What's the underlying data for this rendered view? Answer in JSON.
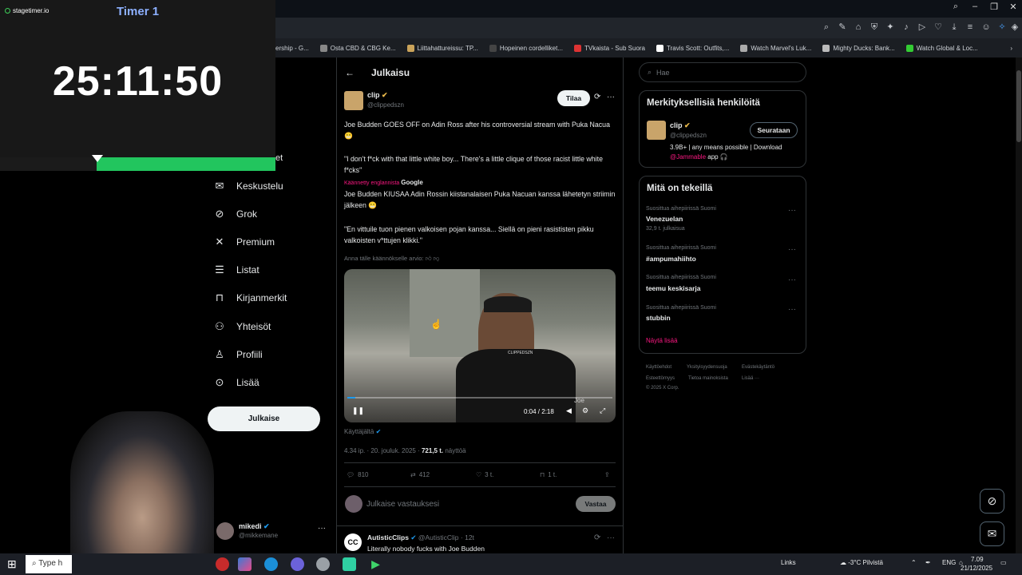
{
  "timer": {
    "brand": "stagetimer.io",
    "title": "Timer 1",
    "display": "25:11:50",
    "progress_fraction": 0.65
  },
  "bookmarks": [
    "ership - G...",
    "Osta CBD & CBG Ke...",
    "Liittahattureissu: TP...",
    "Hopeinen cordelliket...",
    "TVkaista - Sub Suora",
    "Travis Scott: Outfits,...",
    "Watch Marvel's Luk...",
    "Mighty Ducks: Bank...",
    "Watch Global & Loc..."
  ],
  "nav": {
    "partial_label": "et",
    "items": [
      {
        "label": "Keskustelu",
        "icon": "mail-icon"
      },
      {
        "label": "Grok",
        "icon": "grok-icon"
      },
      {
        "label": "Premium",
        "icon": "x-icon"
      },
      {
        "label": "Listat",
        "icon": "list-icon"
      },
      {
        "label": "Kirjanmerkit",
        "icon": "bookmark-icon"
      },
      {
        "label": "Yhteisöt",
        "icon": "communities-icon"
      },
      {
        "label": "Profiili",
        "icon": "profile-icon"
      },
      {
        "label": "Lisää",
        "icon": "more-icon"
      }
    ],
    "post_button": "Julkaise",
    "account": {
      "name": "mikedi",
      "handle": "@mikkemane"
    }
  },
  "post": {
    "header_title": "Julkaisu",
    "author_name": "clip",
    "author_handle": "@clippedszn",
    "subscribe_label": "Tilaa",
    "text_original_1": "Joe Budden GOES OFF on Adin Ross after his controversial stream with Puka Nacua 😬",
    "text_original_2": "\"I don't f*ck with that little white boy... There's a little clique of those racist little white f*cks\"",
    "translated_from": "Käännetty englannista",
    "translator": "Google",
    "text_translated_1": "Joe Budden KIUSAA Adin Rossin kiistanalaisen Puka Nacuan kanssa lähetetyn striimin jälkeen 😬",
    "text_translated_2": "\"En vittuile tuon pienen valkoisen pojan kanssa... Siellä on pieni rasististen pikku valkoisten v*ttujen klikki.\"",
    "rate_translation": "Anna tälle käännökselle arvio:",
    "video_time": "0:04 / 2:18",
    "video_progress_fraction": 0.03,
    "video_watermark": "CLIPPEDSZN",
    "video_caption_partial": "Joe",
    "from_user_label": "Käyttäjältä",
    "time": "4.34 ip.",
    "date": "20. jouluk. 2025",
    "views_value": "721,5 t.",
    "views_label": "näyttöä",
    "replies": "810",
    "reposts": "412",
    "likes": "3 t.",
    "bookmarks": "1 t.",
    "reply_placeholder": "Julkaise vastauksesi",
    "reply_button": "Vastaa"
  },
  "reply_tweet": {
    "author_name": "AutisticClips",
    "author_handle": "@AutisticClip",
    "time": "12t",
    "text": "Literally nobody fucks with Joe Budden"
  },
  "sidebar": {
    "search_placeholder": "Hae",
    "relevant_title": "Merkityksellisiä henkilöitä",
    "relevant_user": {
      "name": "clip",
      "handle": "@clippedszn",
      "follow_label": "Seurataan",
      "bio_1": "3.9B+ | any means possible | Download",
      "bio_link": "@Jammable",
      "bio_2": "app 🎧"
    },
    "trends_title": "Mitä on tekeillä",
    "trends": [
      {
        "context": "Suosittua aihepiirissä Suomi",
        "name": "Venezuelan",
        "count": "32,9 t. julkaisua"
      },
      {
        "context": "Suosittua aihepiirissä Suomi",
        "name": "#ampumahiihto",
        "count": ""
      },
      {
        "context": "Suosittua aihepiirissä Suomi",
        "name": "teemu keskisarja",
        "count": ""
      },
      {
        "context": "Suosittua aihepiirissä Suomi",
        "name": "stubbin",
        "count": ""
      }
    ],
    "show_more": "Näytä lisää",
    "footer_links": [
      "Käyttöehdot",
      "Yksityisyydensuoja",
      "Evästekäytäntö",
      "Esteettömyys",
      "Tietoa mainoksista",
      "Lisää ···"
    ],
    "copyright": "© 2025 X Corp."
  },
  "taskbar": {
    "search_placeholder": "Type h",
    "links_label": "Links",
    "weather": "-3°C Pilvistä",
    "language": "ENG",
    "time": "7.09",
    "date": "21/12/2025"
  }
}
